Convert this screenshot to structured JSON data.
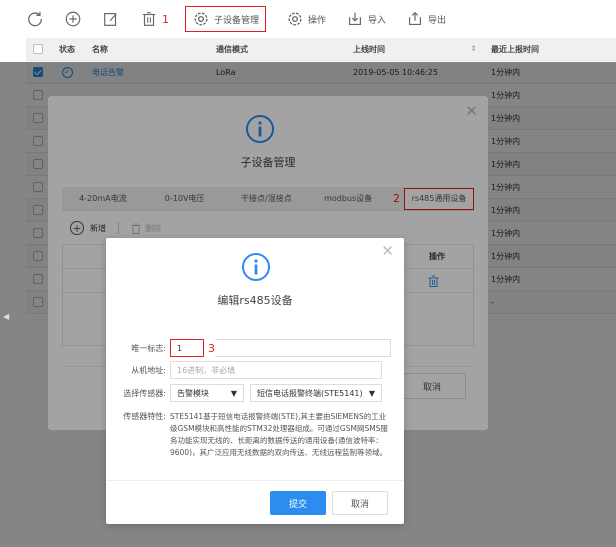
{
  "toolbar": {
    "refresh_label": "",
    "add_label": "",
    "edit_label": "",
    "delete_label": "",
    "subdevice_label": "子设备管理",
    "annotation_1": "1",
    "operation_label": "操作",
    "import_label": "导入",
    "export_label": "导出"
  },
  "table": {
    "headers": {
      "status": "状态",
      "name": "名称",
      "comm_mode": "通信模式",
      "online_time": "上线时间",
      "last_report": "最近上报时间"
    },
    "rows": [
      {
        "checked": true,
        "name": "电话告警",
        "comm_mode": "LoRa",
        "online_time": "2019-05-05 10:46:25",
        "last_report": "1分钟内"
      },
      {
        "checked": false,
        "name": "",
        "comm_mode": "",
        "online_time": "",
        "last_report": "1分钟内"
      },
      {
        "checked": false,
        "name": "",
        "comm_mode": "",
        "online_time": "",
        "last_report": "1分钟内"
      },
      {
        "checked": false,
        "name": "",
        "comm_mode": "",
        "online_time": "",
        "last_report": "1分钟内"
      },
      {
        "checked": false,
        "name": "",
        "comm_mode": "",
        "online_time": "",
        "last_report": "1分钟内"
      },
      {
        "checked": false,
        "name": "",
        "comm_mode": "",
        "online_time": "",
        "last_report": "1分钟内"
      },
      {
        "checked": false,
        "name": "",
        "comm_mode": "",
        "online_time": "",
        "last_report": "1分钟内"
      },
      {
        "checked": false,
        "name": "",
        "comm_mode": "",
        "online_time": "",
        "last_report": "1分钟内"
      },
      {
        "checked": false,
        "name": "",
        "comm_mode": "",
        "online_time": "",
        "last_report": "1分钟内"
      },
      {
        "checked": false,
        "name": "",
        "comm_mode": "",
        "online_time": "",
        "last_report": "1分钟内"
      },
      {
        "checked": false,
        "name": "",
        "comm_mode": "",
        "online_time": "",
        "last_report": "-"
      }
    ]
  },
  "modal1": {
    "title": "子设备管理",
    "tabs": [
      "4-20mA电流",
      "0-10V电压",
      "干接点/湿接点",
      "modbus设备",
      "rs485通用设备"
    ],
    "annotation_2": "2",
    "add_label": "新增",
    "delete_label": "删除",
    "op_header": "操作",
    "cancel_label": "取消"
  },
  "modal2": {
    "title": "编辑rs485设备",
    "unique_id_label": "唯一标志:",
    "unique_id_value": "1",
    "annotation_3": "3",
    "slave_addr_label": "从机地址:",
    "slave_addr_placeholder": "16进制，非必填",
    "sensor_label": "选择传感器:",
    "sensor_type": "告警模块",
    "sensor_model": "短信电话报警终端(STE5141)",
    "feature_label": "传感器特性:",
    "feature_text": "STE5141基于短信电话报警终端(STE),其主要由SIEMENS的工业级GSM模块和高性能的STM32处理器组成。可通过GSM网SMS服务功能实现无线的、长距离的数据传送的通用设备(通信波特率：9600)，其广泛应用无线数据的双向传送、无线远程监制等领域。",
    "submit_label": "提交",
    "cancel_label": "取消"
  },
  "colors": {
    "accent": "#2d8cf0",
    "annotation": "#e02020"
  }
}
